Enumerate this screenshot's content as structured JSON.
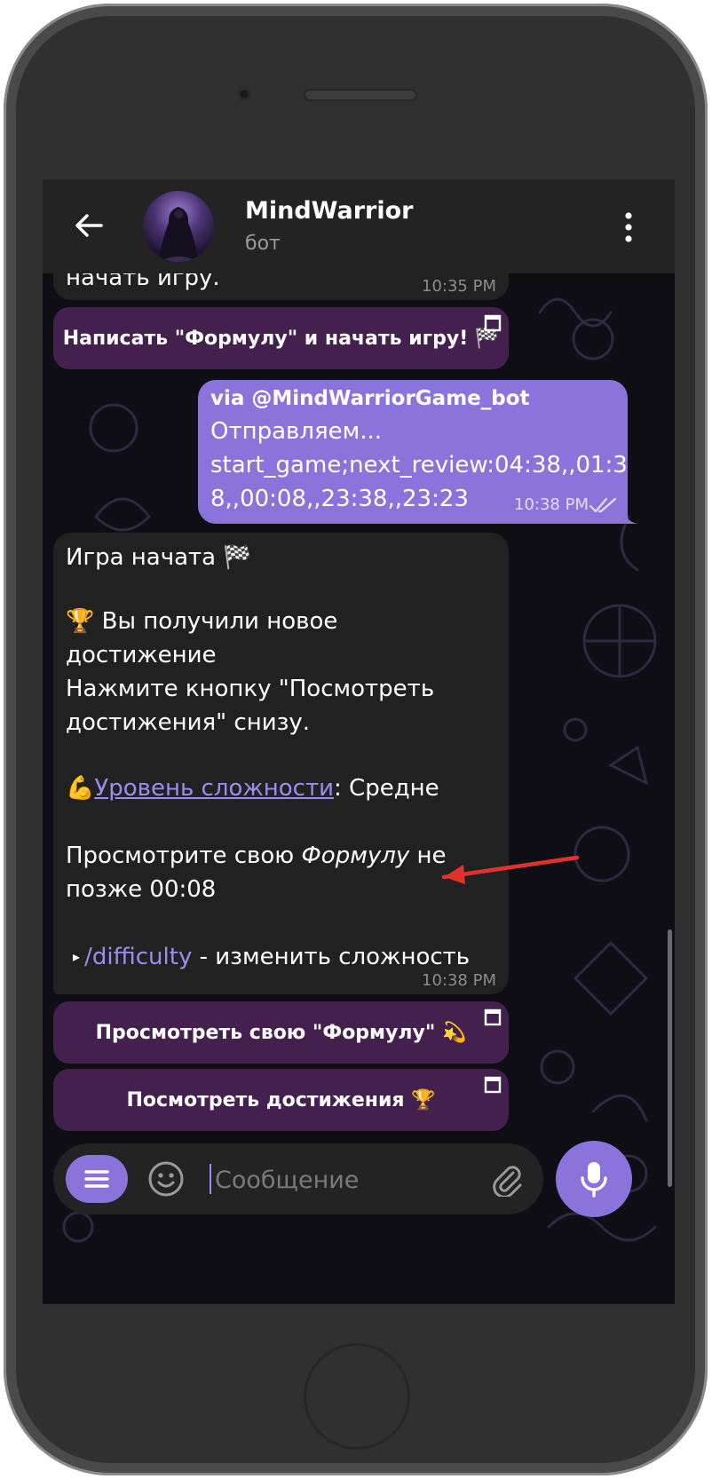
{
  "header": {
    "title": "MindWarrior",
    "subtitle": "бот"
  },
  "messages": {
    "partial_incoming": {
      "text": "начать игру.",
      "time": "10:35 PM"
    },
    "btn_write_formula": "Написать \"Формулу\" и начать игру! 🏁",
    "outgoing": {
      "via": "via @MindWarriorGame_bot",
      "line1": "Отправляем...",
      "line2": "start_game;next_review:04:38,,01:3",
      "line3": "8,,00:08,,23:38,,23:23",
      "time": "10:38 PM"
    },
    "game_started": {
      "line1": "Игра начата 🏁",
      "line2": "🏆 Вы получили новое",
      "line3": "достижение",
      "line4": "Нажмите кнопку \"Посмотреть",
      "line5": "достижения\" снизу.",
      "difficulty_emoji": "💪",
      "difficulty_link": "Уровень сложности",
      "difficulty_value": ": Средне",
      "review_prefix": "Просмотрите свою ",
      "review_italic": "Формулу",
      "review_suffix": " не",
      "review_line2": "позже 00:08",
      "cmd_bullet": "▸ ",
      "cmd": "/difficulty",
      "cmd_desc": " - изменить сложность",
      "time": "10:38 PM"
    },
    "btn_view_formula": "Просмотреть свою \"Формулу\" 💫",
    "btn_view_achievements": "Посмотреть достижения 🏆"
  },
  "composer": {
    "placeholder": "Сообщение"
  },
  "colors": {
    "accent": "#8a74dc",
    "inline_button": "#44204e",
    "annotation_arrow": "#e0322a"
  },
  "icons": [
    "back-arrow-icon",
    "more-vertical-icon",
    "menu-icon",
    "emoji-icon",
    "attach-icon",
    "mic-icon",
    "open-link-icon",
    "double-check-icon"
  ]
}
